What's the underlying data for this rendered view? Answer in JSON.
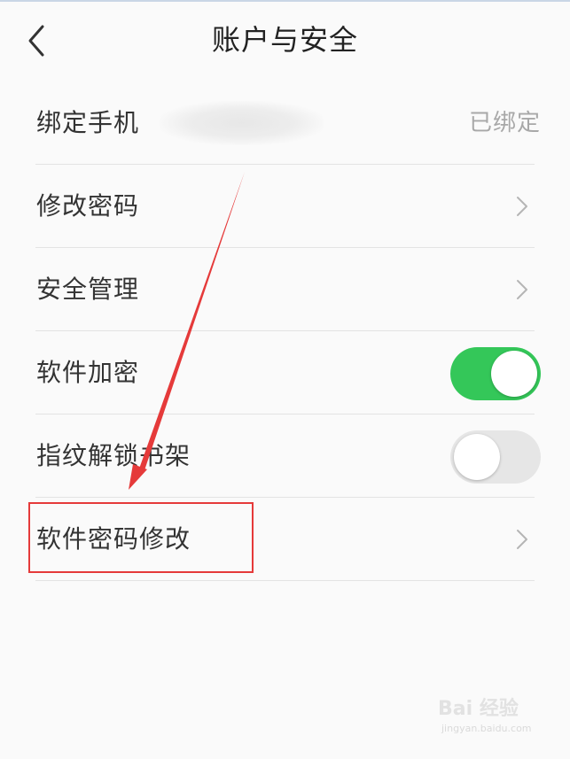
{
  "header": {
    "title": "账户与安全",
    "back_icon": "chevron-left-icon"
  },
  "settings": {
    "bind_phone": {
      "label": "绑定手机",
      "status": "已绑定"
    },
    "change_password": {
      "label": "修改密码",
      "icon": "chevron-right-icon"
    },
    "security_management": {
      "label": "安全管理",
      "icon": "chevron-right-icon"
    },
    "software_encryption": {
      "label": "软件加密",
      "toggle": "on"
    },
    "fingerprint_unlock": {
      "label": "指纹解锁书架",
      "toggle": "off"
    },
    "software_password_change": {
      "label": "软件密码修改",
      "icon": "chevron-right-icon"
    }
  },
  "annotations": {
    "highlight_color": "#e53a3a",
    "arrow_color": "#e53a3a"
  },
  "colors": {
    "toggle_on": "#34c759",
    "toggle_off": "#e6e6e6"
  },
  "watermark": {
    "main": "Bai 经验",
    "sub": "jingyan.baidu.com"
  }
}
